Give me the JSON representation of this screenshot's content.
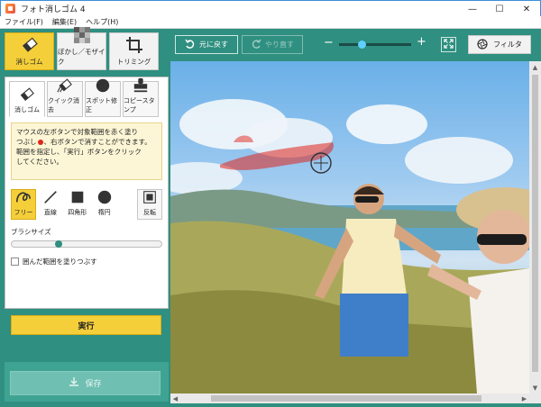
{
  "window": {
    "title": "フォト消しゴム 4",
    "minimize": "—",
    "maximize": "☐",
    "close": "✕"
  },
  "menu": {
    "items": [
      "ファイル(F)",
      "編集(E)",
      "ヘルプ(H)"
    ]
  },
  "mode_tabs": [
    {
      "label": "消しゴム",
      "icon": "eraser-icon",
      "active": true
    },
    {
      "label": "ぼかし／モザイク",
      "icon": "mosaic-icon",
      "active": false
    },
    {
      "label": "トリミング",
      "icon": "crop-icon",
      "active": false
    }
  ],
  "tool_tabs": [
    {
      "label": "消しゴム",
      "icon": "eraser-icon",
      "active": true
    },
    {
      "label": "クイック消去",
      "icon": "quick-erase-icon",
      "active": false
    },
    {
      "label": "スポット修正",
      "icon": "spot-fix-icon",
      "active": false
    },
    {
      "label": "コピースタンプ",
      "icon": "stamp-icon",
      "active": false
    }
  ],
  "help": {
    "line1": "マウスの左ボタンで対象範囲を赤く塗り",
    "line2a": "つぶし",
    "line2b": "、右ボタンで消すことができます。",
    "line3": "範囲を指定し、「実行」ボタンをクリック",
    "line4": "してください。"
  },
  "shapes": [
    {
      "label": "フリー",
      "icon": "freehand-icon",
      "active": true
    },
    {
      "label": "直線",
      "icon": "line-icon",
      "active": false
    },
    {
      "label": "四角形",
      "icon": "rectangle-icon",
      "active": false
    },
    {
      "label": "楕円",
      "icon": "ellipse-icon",
      "active": false
    }
  ],
  "flip": {
    "label": "反転",
    "icon": "invert-icon"
  },
  "brush": {
    "label": "ブラシサイズ",
    "value": 0.3
  },
  "fill_option": {
    "label": "囲んだ範囲を塗りつぶす",
    "checked": false
  },
  "run_label": "実行",
  "save_label": "保存",
  "toolbar": {
    "undo_label": "元に戻す",
    "redo_label": "やり直す",
    "filter_label": "フィルタ",
    "zoom_value": 0.3
  },
  "colors": {
    "teal": "#2f8f80",
    "yellow": "#f5cf3a",
    "mark_red": "#e0251b"
  }
}
